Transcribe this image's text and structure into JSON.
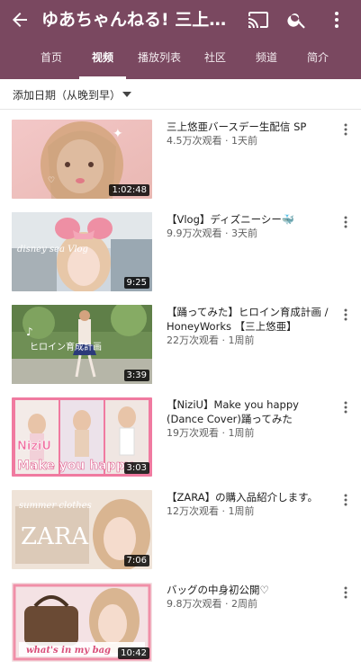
{
  "header": {
    "title": "ゆあちゃんねる! 三上悠亜",
    "icons": [
      "back-arrow-icon",
      "cast-icon",
      "search-icon",
      "more-vertical-icon"
    ],
    "tabs": [
      {
        "label": "首页"
      },
      {
        "label": "视频"
      },
      {
        "label": "播放列表"
      },
      {
        "label": "社区"
      },
      {
        "label": "频道"
      },
      {
        "label": "简介"
      }
    ],
    "active_tab": "视频",
    "color": "#7a4860"
  },
  "sort": {
    "label": "添加日期（从晚到早）"
  },
  "videos": [
    {
      "title": "三上悠亜バースデー生配信 SP",
      "meta": "4.5万次观看 · 1天前",
      "duration": "1:02:48"
    },
    {
      "title": "【Vlog】ディズニーシー🐳",
      "meta": "9.9万次观看 · 3天前",
      "duration": "9:25",
      "thumb_text": "disney sea Vlog"
    },
    {
      "title": "【踊ってみた】ヒロイン育成計画 / HoneyWorks 【三上悠亜】",
      "meta": "22万次观看 · 1周前",
      "duration": "3:39",
      "thumb_text": "ヒロイン育成計画"
    },
    {
      "title": "【NiziU】Make you happy (Dance Cover)踊ってみた",
      "meta": "19万次观看 · 1周前",
      "duration": "3:03",
      "thumb_text_1": "NiziU",
      "thumb_text_2": "Make you happy"
    },
    {
      "title": "【ZARA】の購入品紹介します。",
      "meta": "12万次观看 · 1周前",
      "duration": "7:06",
      "thumb_text_1": "summer clothes",
      "thumb_text_2": "ZARA"
    },
    {
      "title": "バッグの中身初公開♡",
      "meta": "9.8万次观看 · 2周前",
      "duration": "10:42",
      "thumb_text": "what's in my bag"
    }
  ]
}
